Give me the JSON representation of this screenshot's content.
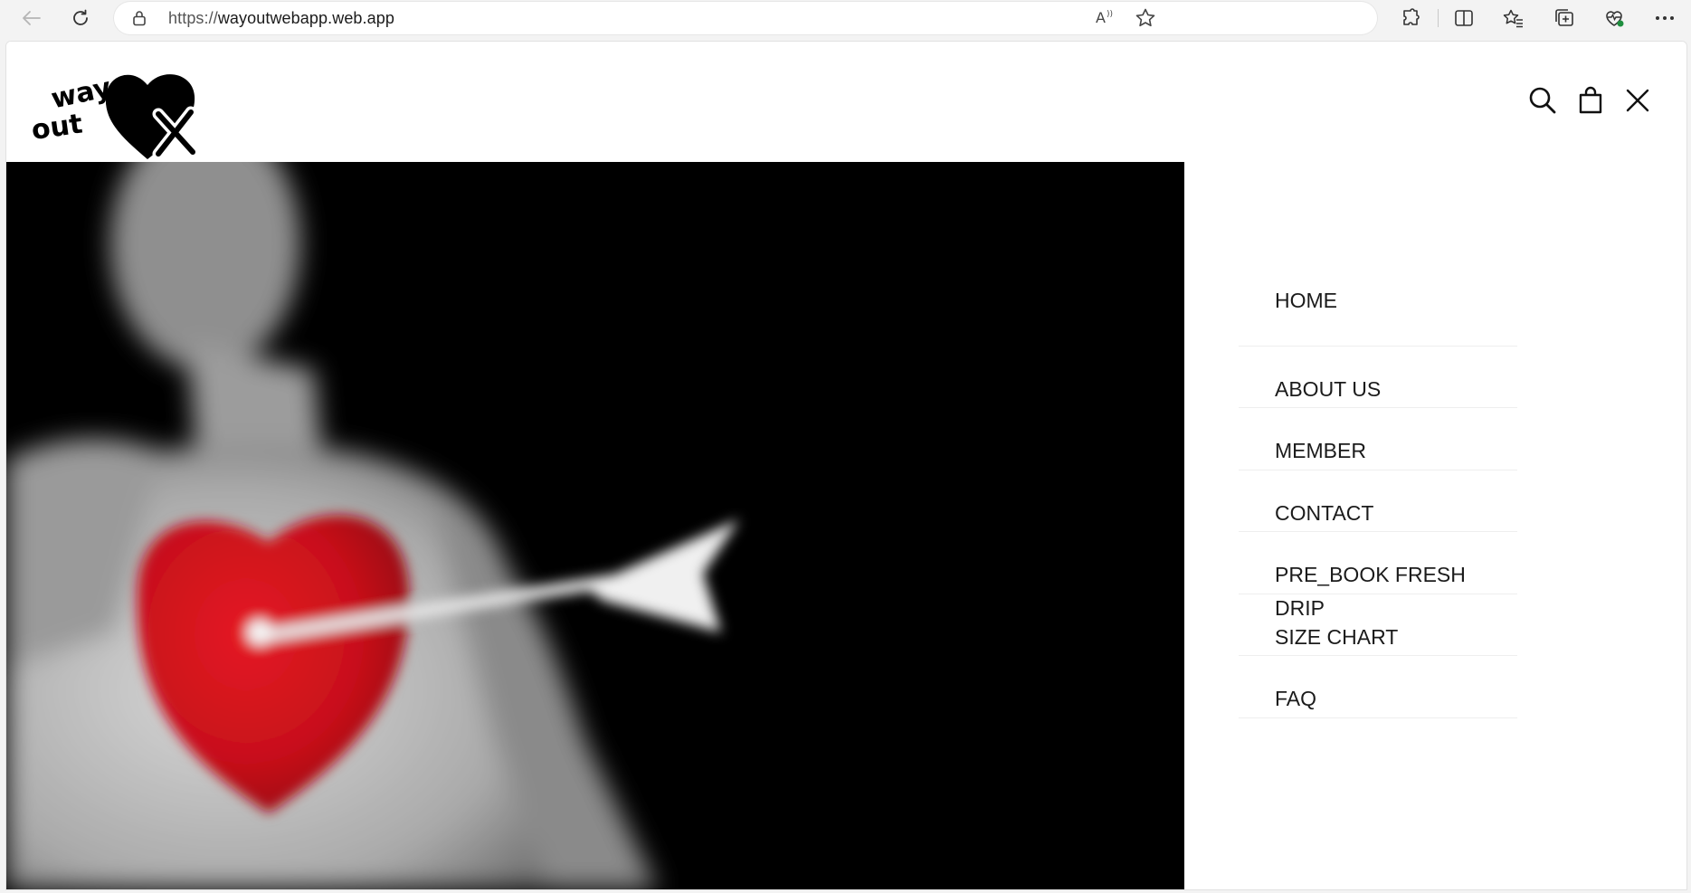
{
  "browser": {
    "url_prefix": "https://",
    "url_host": "wayoutwebapp.web.app",
    "icons": {
      "back": "back-arrow-icon",
      "refresh": "refresh-icon",
      "lock": "lock-icon",
      "read_aloud": "read-aloud-icon",
      "favorite": "star-icon",
      "extensions": "puzzle-icon",
      "split_screen": "split-screen-icon",
      "favorites_bar": "favorites-icon",
      "collections": "collections-icon",
      "health": "browser-essentials-icon",
      "more": "more-dots-icon"
    }
  },
  "site": {
    "logo_text_top": "way",
    "logo_text_bottom": "out",
    "logo_mark": "X",
    "header_icons": [
      "search-icon",
      "shopping-bag-icon",
      "close-icon"
    ],
    "colors": {
      "hero_bg": "#000000",
      "heart_red": "#d0111a",
      "text": "#1b1b1b"
    }
  },
  "menu": {
    "items": [
      {
        "label": "HOME"
      },
      {
        "label": "ABOUT US"
      },
      {
        "label": "MEMBER"
      },
      {
        "label": "CONTACT"
      },
      {
        "label": "PRE_BOOK FRESH DRIP"
      },
      {
        "label": "SIZE CHART"
      },
      {
        "label": "FAQ"
      }
    ]
  }
}
